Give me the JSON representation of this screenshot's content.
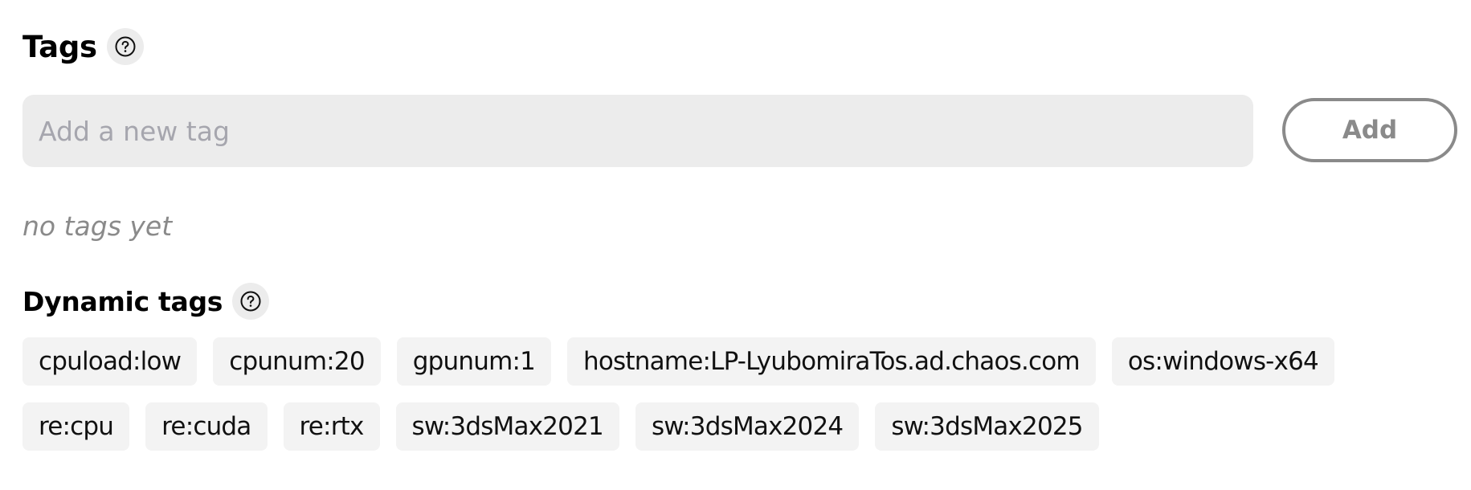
{
  "tags": {
    "heading": "Tags",
    "help_icon": "question-circle-icon",
    "input_value": "",
    "input_placeholder": "Add a new tag",
    "add_button_label": "Add",
    "empty_message": "no tags yet"
  },
  "dynamic_tags": {
    "heading": "Dynamic tags",
    "help_icon": "question-circle-icon",
    "row1": [
      "cpuload:low",
      "cpunum:20",
      "gpunum:1",
      "hostname:LP-LyubomiraTos.ad.chaos.com",
      "os:windows-x64"
    ],
    "row2": [
      "re:cpu",
      "re:cuda",
      "re:rtx",
      "sw:3dsMax2021",
      "sw:3dsMax2024",
      "sw:3dsMax2025"
    ]
  },
  "colors": {
    "input_background": "#ececec",
    "chip_background": "#f3f3f3",
    "button_border": "#8a8a8a",
    "placeholder": "#a6a6ae",
    "muted_text": "#8a8a8a"
  }
}
